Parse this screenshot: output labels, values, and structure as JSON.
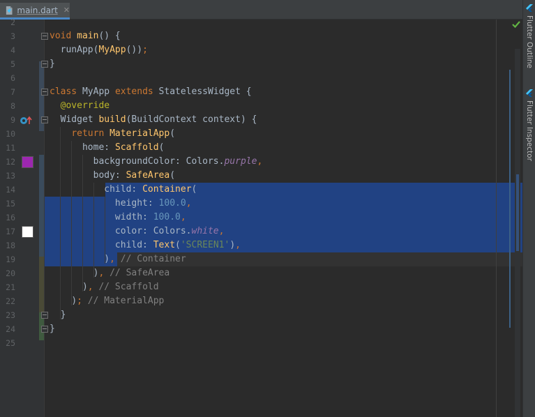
{
  "tab": {
    "label": "main.dart",
    "close": "✕"
  },
  "side_panels": {
    "outline": "Flutter Outline",
    "inspector": "Flutter Inspector"
  },
  "colors": {
    "purple_swatch": "#9c27b0",
    "white_swatch": "#ffffff",
    "selection": "#214283"
  },
  "icons": {
    "file": "dart-file-icon",
    "close": "close-icon",
    "override": "override-method-icon",
    "bulb": "intention-bulb-icon",
    "check": "no-problems-check-icon",
    "flutter": "flutter-icon"
  },
  "line_numbers": [
    "2",
    "3",
    "4",
    "5",
    "6",
    "7",
    "8",
    "9",
    "10",
    "11",
    "12",
    "13",
    "14",
    "15",
    "16",
    "17",
    "18",
    "19",
    "20",
    "21",
    "22",
    "23",
    "24",
    "25"
  ],
  "code": {
    "l3": {
      "kw": "void",
      "sp": " ",
      "fn": "main",
      "rest": "() {"
    },
    "l4": {
      "indent": "  ",
      "fn": "runApp",
      "p1": "(",
      "cls": "MyApp",
      "p2": "())",
      "semi": ";"
    },
    "l5": {
      "text": "}"
    },
    "l7": {
      "kw1": "class",
      "t1": " MyApp ",
      "kw2": "extends",
      "t2": " StatelessWidget {"
    },
    "l8": {
      "indent": "  ",
      "an": "@override"
    },
    "l9": {
      "indent": "  ",
      "t1": "Widget ",
      "fn": "build",
      "t2": "(BuildContext context) {"
    },
    "l10": {
      "indent": "    ",
      "kw": "return",
      "sp": " ",
      "fn": "MaterialApp",
      "p": "("
    },
    "l11": {
      "indent": "      ",
      "t1": "home: ",
      "fn": "Scaffold",
      "p": "("
    },
    "l12": {
      "indent": "        ",
      "t1": "backgroundColor: Colors.",
      "it": "purple",
      "comma": ","
    },
    "l13": {
      "indent": "        ",
      "t1": "body: ",
      "fn": "SafeArea",
      "p": "("
    },
    "l14": {
      "indent": "          ",
      "t1": "child: ",
      "fn": "Container",
      "p": "("
    },
    "l15": {
      "indent": "            ",
      "t1": "height: ",
      "num": "100.0",
      "comma": ","
    },
    "l16": {
      "indent": "            ",
      "t1": "width: ",
      "num": "100.0",
      "comma": ","
    },
    "l17": {
      "indent": "            ",
      "t1": "color: Colors.",
      "it": "white",
      "comma": ","
    },
    "l18": {
      "indent": "            ",
      "t1": "child: ",
      "fn": "Text",
      "p1": "(",
      "str": "'SCREEN1'",
      "p2": ")",
      "comma": ","
    },
    "l19": {
      "indent": "          ",
      "p": ")",
      "comma": ",",
      "cm": " // Container"
    },
    "l20": {
      "indent": "        ",
      "p": ")",
      "comma": ",",
      "cm": " // SafeArea"
    },
    "l21": {
      "indent": "      ",
      "p": ")",
      "comma": ",",
      "cm": " // Scaffold"
    },
    "l22": {
      "indent": "    ",
      "p": ")",
      "semi": ";",
      "cm": " // MaterialApp"
    },
    "l23": {
      "indent": "  ",
      "text": "}"
    },
    "l24": {
      "text": "}"
    }
  }
}
